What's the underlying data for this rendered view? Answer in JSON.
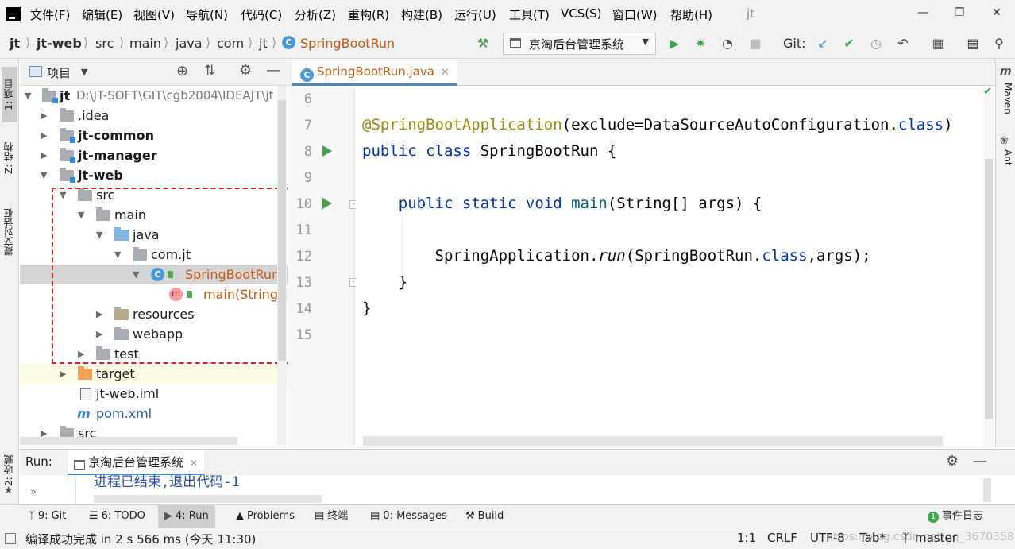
{
  "menubar": {
    "items": [
      "文件(F)",
      "编辑(E)",
      "视图(V)",
      "导航(N)",
      "代码(C)",
      "分析(Z)",
      "重构(R)",
      "构建(B)",
      "运行(U)",
      "工具(T)",
      "VCS(S)",
      "窗口(W)",
      "帮助(H)"
    ],
    "window_title": "jt"
  },
  "navbar": {
    "breadcrumbs": [
      "jt",
      "jt-web",
      "src",
      "main",
      "java",
      "com",
      "jt",
      "SpringBootRun"
    ],
    "run_config": "京淘后台管理系统",
    "git_label": "Git:"
  },
  "left_stripe": {
    "tabs": [
      "1: 项目",
      "Z: 结构",
      "提交对话框",
      "2: 收藏"
    ]
  },
  "project_panel": {
    "title": "项目",
    "tree": [
      {
        "label": "jt",
        "extra": "D:\\JT-SOFT\\GIT\\cgb2004\\IDEAJT\\jt",
        "bold": true
      },
      {
        "label": ".idea"
      },
      {
        "label": "jt-common",
        "bold": true
      },
      {
        "label": "jt-manager",
        "bold": true
      },
      {
        "label": "jt-web",
        "bold": true
      },
      {
        "label": "src"
      },
      {
        "label": "main"
      },
      {
        "label": "java"
      },
      {
        "label": "com.jt"
      },
      {
        "label": "SpringBootRun"
      },
      {
        "label": "main(String[]):"
      },
      {
        "label": "resources"
      },
      {
        "label": "webapp"
      },
      {
        "label": "test"
      },
      {
        "label": "target"
      },
      {
        "label": "jt-web.iml"
      },
      {
        "label": "pom.xml"
      },
      {
        "label": "src"
      }
    ]
  },
  "editor": {
    "tab": "SpringBootRun.java",
    "line_numbers": [
      "6",
      "7",
      "8",
      "9",
      "10",
      "11",
      "12",
      "13",
      "14",
      "15"
    ],
    "code": {
      "l7_ann": "@SpringBootApplication",
      "l7_rest": "(exclude=DataSourceAutoConfiguration.",
      "l7_kw": "class",
      "l7_end": ")",
      "l8_kw": "public class ",
      "l8_rest": "SpringBootRun {",
      "l10_kw": "public static void ",
      "l10_fn": "main",
      "l10_rest": "(String[] args) {",
      "l12_a": "SpringApplication.",
      "l12_it": "run",
      "l12_b": "(SpringBootRun.",
      "l12_kw": "class",
      "l12_c": ",args);",
      "l13": "}",
      "l14": "}"
    }
  },
  "right_stripe": {
    "tabs": [
      "Maven",
      "Ant"
    ]
  },
  "run_panel": {
    "label": "Run:",
    "tab": "京淘后台管理系统",
    "output": "进程已结束,退出代码-1"
  },
  "tool_windows": [
    {
      "label": "9: Git"
    },
    {
      "label": "6: TODO"
    },
    {
      "label": "4: Run"
    },
    {
      "label": "Problems"
    },
    {
      "label": "终端"
    },
    {
      "label": "0: Messages"
    },
    {
      "label": "Build"
    },
    {
      "label": "事件日志"
    }
  ],
  "status_bar": {
    "message": "编译成功完成 in 2 s 566 ms (今天 11:30)",
    "position": "1:1",
    "line_sep": "CRLF",
    "encoding": "UTF-8",
    "indent": "Tab*",
    "branch": "master",
    "watermark": "https://blog.csdn.net/qq_36703580"
  },
  "colors": {
    "keyword": "#0033b3",
    "annotation": "#9e880d",
    "method": "#00627a",
    "run_green": "#3ca54e",
    "highlight_box": "#d9232a"
  }
}
